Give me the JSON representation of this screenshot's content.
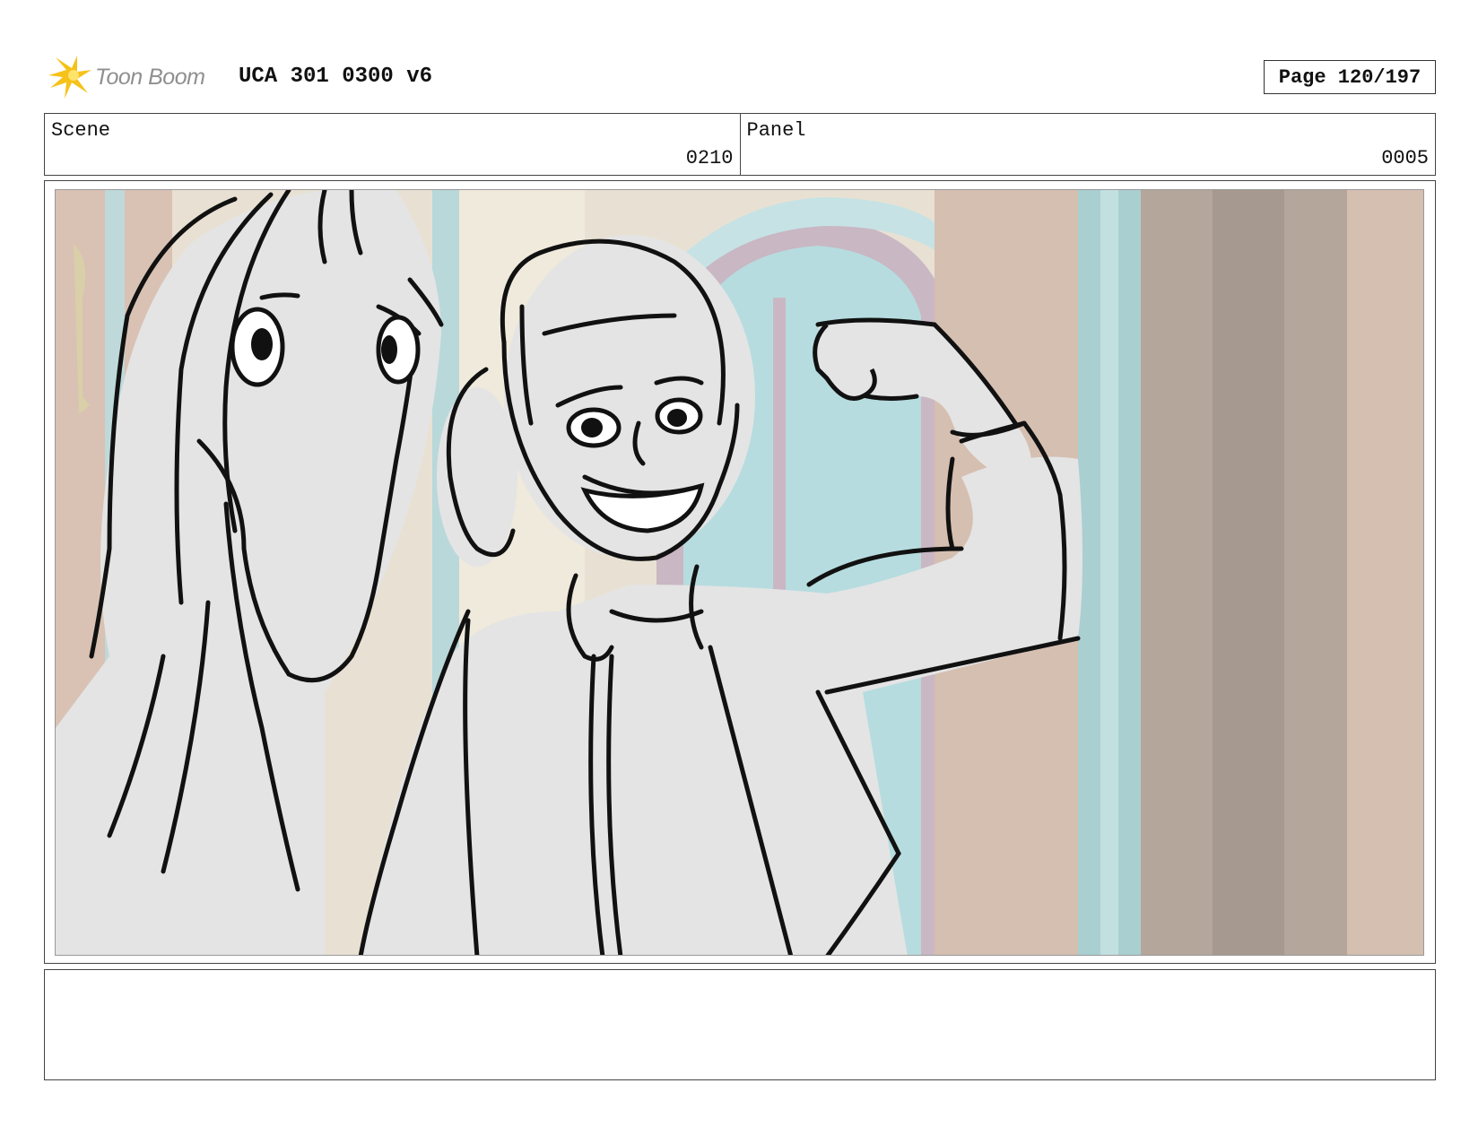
{
  "header": {
    "logo_text": "Toon Boom",
    "title": "UCA 301 0300 v6",
    "page": "Page 120/197"
  },
  "scene": {
    "label": "Scene",
    "value": "0210"
  },
  "panel": {
    "label": "Panel",
    "value": "0005"
  },
  "notes": {
    "text": ""
  },
  "colors": {
    "wall_pink": "#d5bfb1",
    "window_blue": "#b6dcdf",
    "sketch_fill": "#e4e4e4",
    "ink": "#111111"
  }
}
